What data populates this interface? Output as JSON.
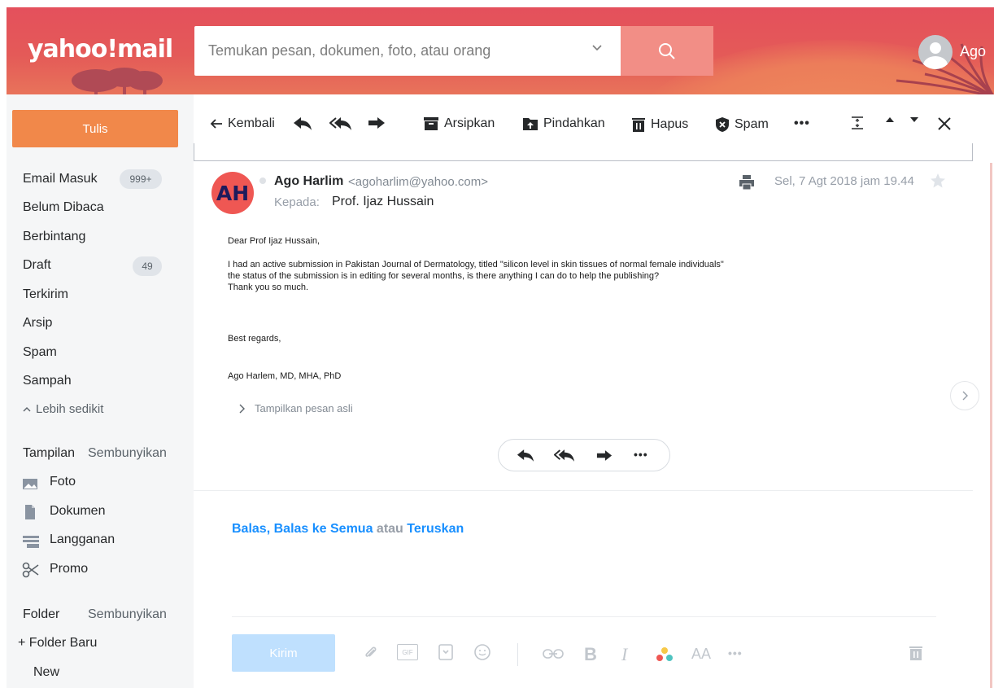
{
  "header": {
    "logo_text": "yahoo!mail",
    "search_placeholder": "Temukan pesan, dokumen, foto, atau orang",
    "username": "Ago"
  },
  "sidebar": {
    "compose_label": "Tulis",
    "folders": [
      {
        "label": "Email Masuk",
        "badge": "999+"
      },
      {
        "label": "Belum Dibaca"
      },
      {
        "label": "Berbintang"
      },
      {
        "label": "Draft",
        "badge": "49"
      },
      {
        "label": "Terkirim"
      },
      {
        "label": "Arsip"
      },
      {
        "label": "Spam"
      },
      {
        "label": "Sampah"
      }
    ],
    "less_label": "Lebih sedikit",
    "views_label": "Tampilan",
    "views_toggle": "Sembunyikan",
    "views": [
      {
        "label": "Foto",
        "icon": "photo-icon"
      },
      {
        "label": "Dokumen",
        "icon": "document-icon"
      },
      {
        "label": "Langganan",
        "icon": "subscription-icon"
      },
      {
        "label": "Promo",
        "icon": "scissors-icon"
      }
    ],
    "folder_label": "Folder",
    "folder_toggle": "Sembunyikan",
    "new_folder_label": "+ Folder Baru",
    "custom_folders": [
      "New"
    ]
  },
  "toolbar": {
    "back_label": "Kembali",
    "archive_label": "Arsipkan",
    "move_label": "Pindahkan",
    "delete_label": "Hapus",
    "spam_label": "Spam",
    "more_label": "•••"
  },
  "message": {
    "avatar_initials": "AH",
    "sender_name": "Ago Harlim",
    "sender_email": "<agoharlim@yahoo.com>",
    "to_label": "Kepada:",
    "to_name": "Prof. Ijaz Hussain",
    "date": "Sel, 7 Agt 2018 jam 19.44",
    "body": [
      "Dear Prof Ijaz Hussain,",
      "I had an active submission in Pakistan Journal of Dermatology, titled \"silicon level in skin tissues of normal female individuals\"",
      "the status of the submission is in editing for several months, is there anything I can do to help the publishing?",
      "Thank you so much.",
      "Best regards,",
      "Ago Harlem, MD, MHA, PhD"
    ],
    "show_original_label": "Tampilkan pesan asli",
    "reply_more": "•••"
  },
  "reply": {
    "reply_link": "Balas",
    "reply_all_link": "Balas ke Semua",
    "or_text": "atau",
    "forward_link": "Teruskan",
    "comma": ",",
    "send_label": "Kirim",
    "gif_label": "GIF",
    "bold_label": "B",
    "italic_label": "I",
    "font_size_label": "AA",
    "more_label": "•••"
  },
  "colors": {
    "header": "#e4505c",
    "compose": "#f1884a",
    "link": "#188fff",
    "send_disabled": "#bfe0fe",
    "avatar": "#ef5753"
  }
}
